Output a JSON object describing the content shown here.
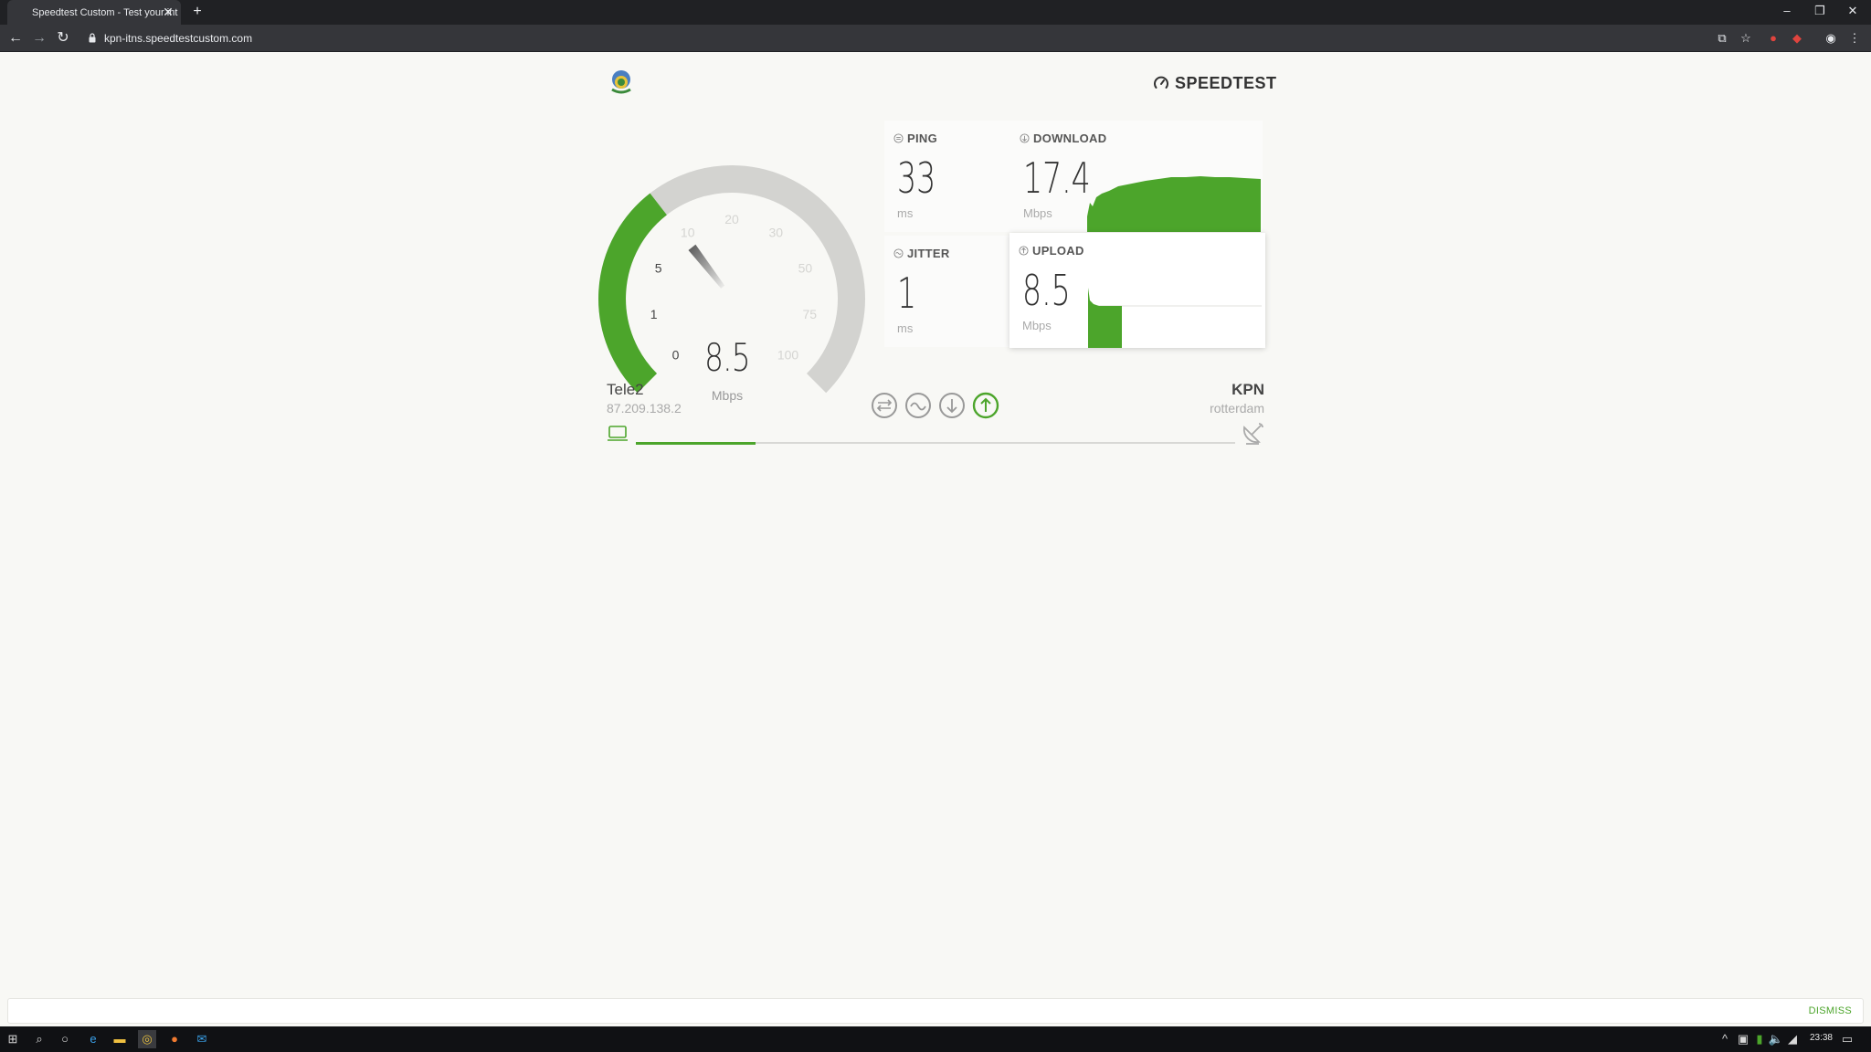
{
  "browser": {
    "tab_title": "Speedtest Custom - Test your int",
    "tab_close": "✕",
    "new_tab": "+",
    "url": "kpn-itns.speedtestcustom.com",
    "window_controls": {
      "minimize": "–",
      "restore": "❐",
      "close": "✕"
    }
  },
  "page": {
    "brand": "SPEEDTEST",
    "gauge": {
      "value": "8.5",
      "unit": "Mbps",
      "ticks": [
        "0",
        "1",
        "5",
        "10",
        "20",
        "30",
        "50",
        "75",
        "100"
      ],
      "progress_fraction": 0.36
    },
    "ping": {
      "label": "PING",
      "value": "33",
      "unit": "ms"
    },
    "jitter": {
      "label": "JITTER",
      "value": "1",
      "unit": "ms"
    },
    "download": {
      "label": "DOWNLOAD",
      "value": "17.4",
      "unit": "Mbps"
    },
    "upload": {
      "label": "UPLOAD",
      "value": "8.5",
      "unit": "Mbps"
    },
    "client": {
      "isp": "Tele2",
      "ip": "87.209.138.2"
    },
    "server": {
      "name": "KPN",
      "location": "rotterdam"
    },
    "test_progress": 0.2,
    "colors": {
      "accent": "#4ca52b",
      "track": "#d3d3d0"
    }
  },
  "notice": {
    "dismiss": "DISMISS"
  },
  "taskbar": {
    "time": "23:38"
  }
}
